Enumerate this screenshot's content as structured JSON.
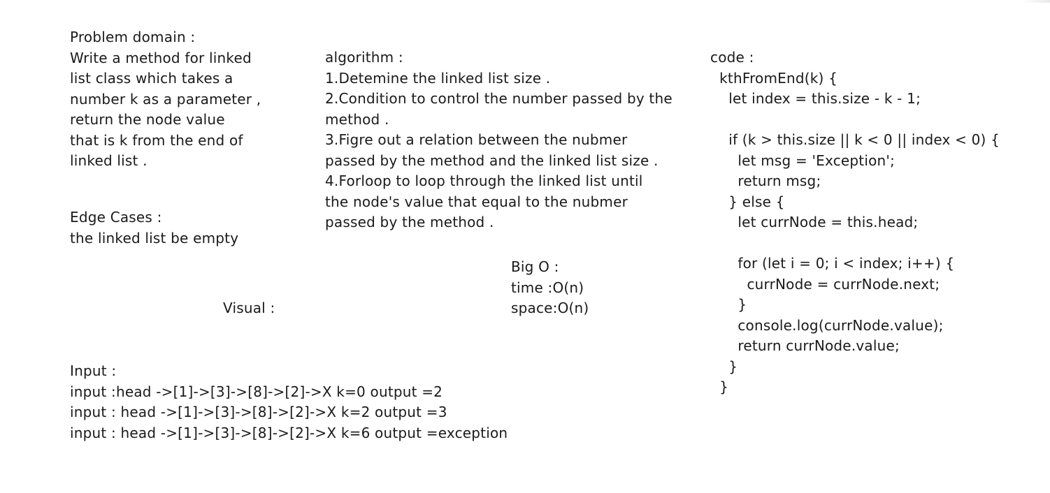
{
  "problem": {
    "title": "Problem domain :",
    "lines": [
      "Write a method for linked",
      "list class which takes a",
      "number k as a parameter ,",
      "return the node value",
      "that is k from the end of",
      "linked list ."
    ]
  },
  "edge": {
    "title": "Edge Cases :",
    "lines": [
      "the linked list be empty"
    ]
  },
  "visual": {
    "title": "Visual :"
  },
  "input": {
    "title": "Input :",
    "lines": [
      "input :head ->[1]->[3]->[8]->[2]->X k=0 output =2",
      "input : head ->[1]->[3]->[8]->[2]->X k=2 output =3",
      "input : head ->[1]->[3]->[8]->[2]->X k=6 output =exception"
    ]
  },
  "algorithm": {
    "title": "algorithm :",
    "lines": [
      "1.Detemine the linked list size .",
      "2.Condition to control the number passed by the",
      "method .",
      "3.Figre out a relation between the nubmer",
      "passed by the method and the linked list size .",
      "4.Forloop to loop through the linked list until",
      "the node's value that equal to the nubmer",
      "passed by the method ."
    ]
  },
  "bigo": {
    "title": "Big O :",
    "lines": [
      "time :O(n)",
      "space:O(n)"
    ]
  },
  "code": {
    "title": "code :",
    "lines": [
      "  kthFromEnd(k) {",
      "    let index = this.size - k - 1;",
      "",
      "    if (k > this.size || k < 0 || index < 0) {",
      "      let msg = 'Exception';",
      "      return msg;",
      "    } else {",
      "      let currNode = this.head;",
      "",
      "      for (let i = 0; i < index; i++) {",
      "        currNode = currNode.next;",
      "      }",
      "      console.log(currNode.value);",
      "      return currNode.value;",
      "    }",
      "  }"
    ]
  }
}
